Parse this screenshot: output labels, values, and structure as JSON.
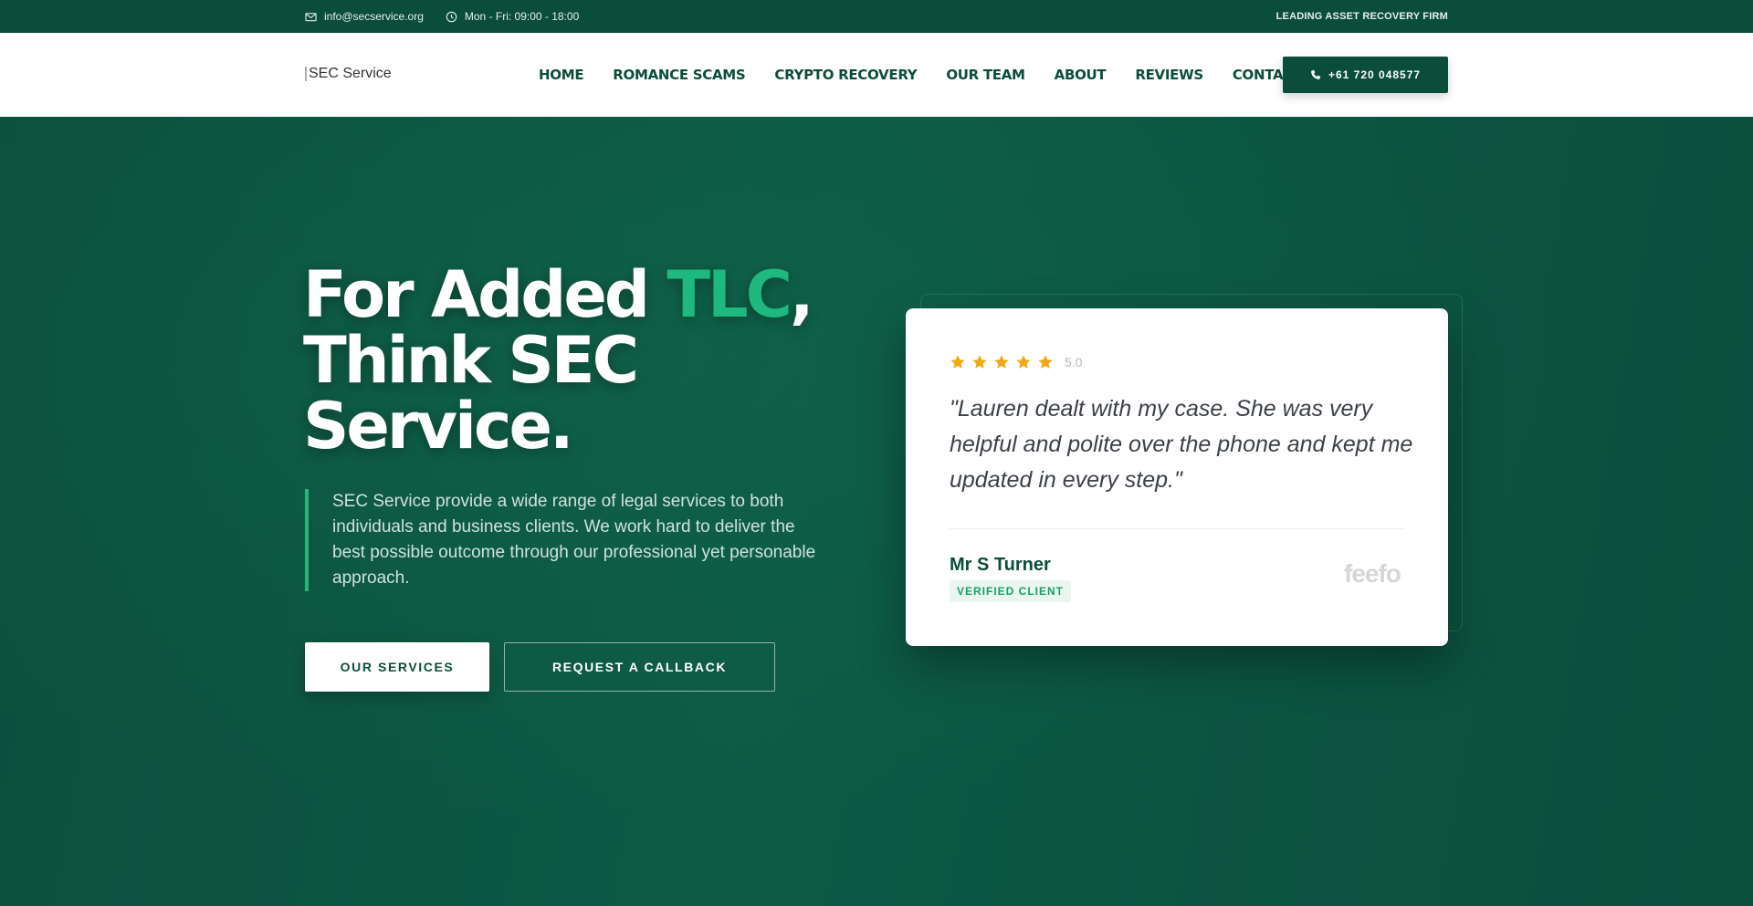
{
  "topbar": {
    "email": "info@secservice.org",
    "hours": "Mon - Fri: 09:00 - 18:00",
    "tagline": "LEADING ASSET RECOVERY FIRM"
  },
  "header": {
    "logo_alt": "SEC Service",
    "nav": [
      "HOME",
      "ROMANCE SCAMS",
      "CRYPTO RECOVERY",
      "OUR TEAM",
      "ABOUT",
      "REVIEWS",
      "CONTACT"
    ],
    "phone": "+61 720 048577"
  },
  "hero": {
    "headline_part1": "For Added ",
    "headline_accent": "TLC",
    "headline_part2": ",",
    "headline_line2": "Think SEC",
    "headline_line3": "Service.",
    "intro": "SEC Service provide a wide range of legal services to both individuals and business clients. We work hard to deliver the best possible outcome through our professional yet personable approach.",
    "btn_services": "OUR SERVICES",
    "btn_callback": "REQUEST A CALLBACK"
  },
  "review": {
    "stars": 5,
    "rating": "5.0",
    "quote": "\"Lauren dealt with my case. She was very helpful and polite over the phone and kept me updated in every step.\"",
    "author": "Mr S Turner",
    "badge": "VERIFIED CLIENT",
    "provider": "feefo"
  },
  "colors": {
    "brand_dark": "#0b4d3b",
    "accent": "#1db97f",
    "star": "#f0a915"
  },
  "icons": [
    "mail-icon",
    "clock-icon",
    "phone-icon",
    "star-icon"
  ]
}
